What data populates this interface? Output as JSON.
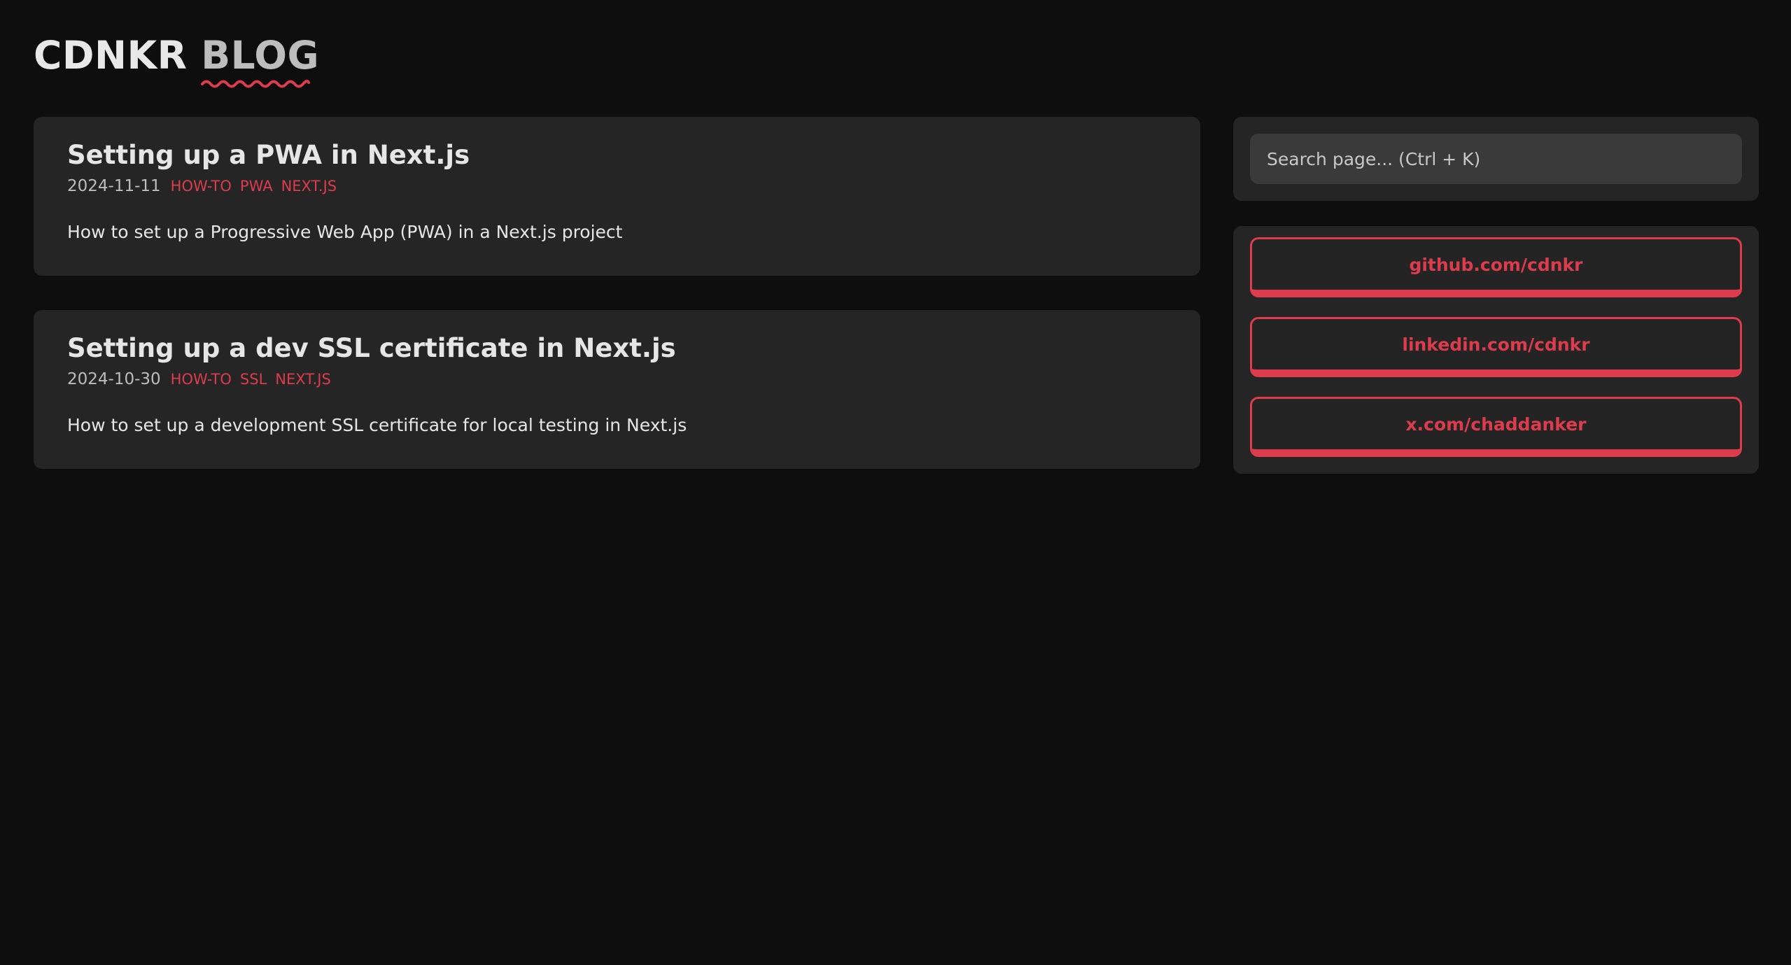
{
  "header": {
    "brand": "CDNKR",
    "blog": "BLOG"
  },
  "posts": [
    {
      "title": "Setting up a PWA in Next.js",
      "date": "2024-11-11",
      "tags": [
        "HOW-TO",
        "PWA",
        "NEXT.JS"
      ],
      "description": "How to set up a Progressive Web App (PWA) in a Next.js project"
    },
    {
      "title": "Setting up a dev SSL certificate in Next.js",
      "date": "2024-10-30",
      "tags": [
        "HOW-TO",
        "SSL",
        "NEXT.JS"
      ],
      "description": "How to set up a development SSL certificate for local testing in Next.js"
    }
  ],
  "search": {
    "placeholder": "Search page... (Ctrl + K)"
  },
  "links": [
    {
      "label": "github.com/cdnkr"
    },
    {
      "label": "linkedin.com/cdnkr"
    },
    {
      "label": "x.com/chaddanker"
    }
  ],
  "colors": {
    "accent": "#dc3c4c",
    "card": "#252525",
    "background": "#0e0e0e"
  }
}
